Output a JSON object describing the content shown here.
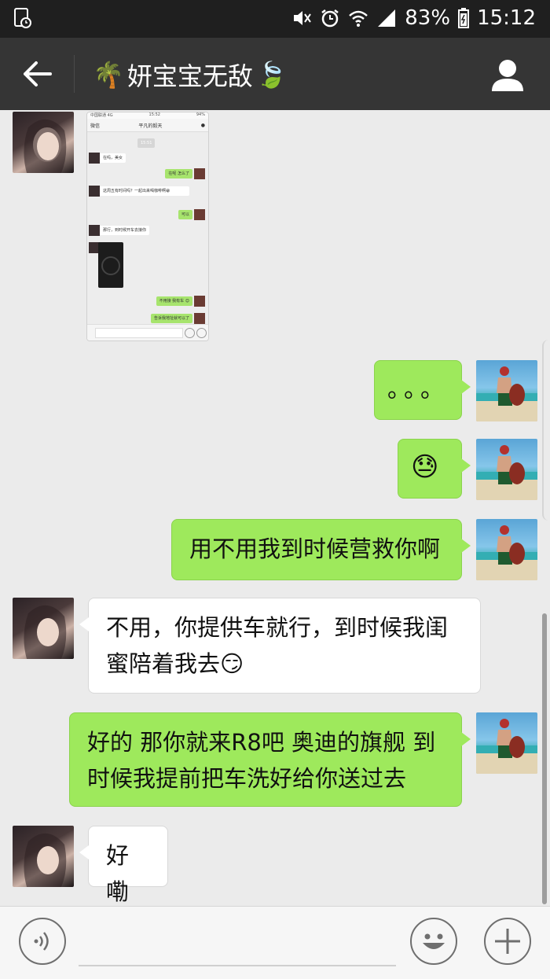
{
  "statusbar": {
    "battery": "83%",
    "time": "15:12",
    "icons": [
      "screen-record-icon",
      "mute-icon",
      "alarm-icon",
      "wifi-icon",
      "signal-icon",
      "battery-icon"
    ]
  },
  "header": {
    "title": "妍宝宝无敌",
    "leading_emoji": "🌴",
    "trailing_emoji": "🍃",
    "icons": [
      "back-arrow-icon",
      "profile-icon"
    ]
  },
  "embedded_screenshot": {
    "status_left": "中国联通 4G",
    "status_time": "15:52",
    "status_right": "94%",
    "back_label": "微信",
    "title": "平凡的毅天",
    "time_badge": "15:51",
    "messages": [
      {
        "dir": "in",
        "text": "在吗，美女"
      },
      {
        "dir": "out",
        "text": "在呢 怎么了"
      },
      {
        "dir": "in",
        "text": "这周五有时间吗？一起出来喝咖啡啊😁"
      },
      {
        "dir": "out",
        "text": "可以"
      },
      {
        "dir": "in",
        "text": "那行，到时候开车去接你"
      },
      {
        "dir": "out",
        "text": "不用接 我有车 😊"
      },
      {
        "dir": "out",
        "text": "告诉我地址就可以了"
      }
    ]
  },
  "messages": [
    {
      "dir": "out",
      "text": "。。。"
    },
    {
      "dir": "out",
      "text": "😓"
    },
    {
      "dir": "out",
      "text": "用不用我到时候营救你啊"
    },
    {
      "dir": "in",
      "text": "不用，你提供车就行，到时候我闺蜜陪着我去😏"
    },
    {
      "dir": "out",
      "text": "好的 那你就来R8吧 奥迪的旗舰 到时候我提前把车洗好给你送过去"
    },
    {
      "dir": "in",
      "text": "好嘞"
    }
  ],
  "bottombar": {
    "icons": [
      "voice-icon",
      "emoji-icon",
      "plus-icon"
    ]
  },
  "colors": {
    "statusbar": "#1f1f1f",
    "titlebar": "#353535",
    "chat_bg": "#ebebeb",
    "outgoing_bubble": "#9ee95c",
    "incoming_bubble": "#ffffff"
  }
}
